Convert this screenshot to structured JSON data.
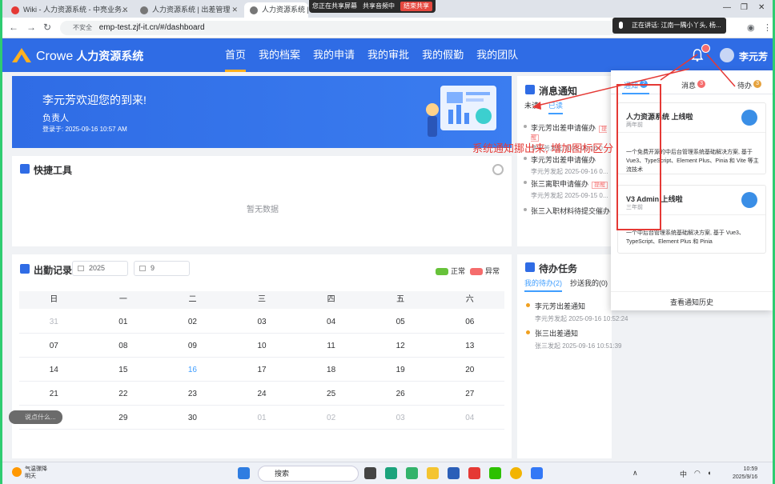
{
  "browser": {
    "tabs": [
      {
        "title": "Wiki - 人力资源系统 - 中亮业务..."
      },
      {
        "title": "人力资源系统 | 出差管理"
      },
      {
        "title": "人力资源系统 | 首页"
      }
    ],
    "share_notice": "您正在共享屏幕",
    "share_audio": "共享音频中",
    "share_stop": "结束共享",
    "speaking": "正在讲话: 江南一隅小丫头, 杨...",
    "url_insecure": "不安全",
    "url": "emp-test.zjf-it.cn/#/dashboard"
  },
  "header": {
    "brand": "Crowe",
    "system_name": "人力资源系统",
    "nav": [
      "首页",
      "我的档案",
      "我的申请",
      "我的审批",
      "我的假勤",
      "我的团队"
    ],
    "active_nav": 0,
    "username": "李元芳",
    "colors": {
      "primary": "#2f6ce5",
      "accent": "#ffb020"
    }
  },
  "welcome": {
    "greeting": "李元芳欢迎您的到来!",
    "role": "负责人",
    "login_label": "登录于: 2025-09-16 10:57 AM"
  },
  "quick_tools": {
    "title": "快捷工具",
    "empty": "暂无数据"
  },
  "messages": {
    "title": "消息通知",
    "tabs": [
      "未读",
      "已读"
    ],
    "remind_badge": "提醒",
    "items": [
      {
        "title": "李元芳出差申请催办",
        "sub": "李元芳发起  2025-09-16 0...",
        "remind": true
      },
      {
        "title": "李元芳出差申请催办",
        "sub": "李元芳发起  2025-09-16 0...",
        "remind": false
      },
      {
        "title": "张三离职申请催办",
        "sub": "李元芳发起  2025-09-15 0...",
        "remind": true
      },
      {
        "title": "张三入职材料待提交催办",
        "sub": "",
        "remind": false
      }
    ]
  },
  "attendance": {
    "title": "出勤记录",
    "year": "2025",
    "month": "9",
    "legend_normal": "正常",
    "legend_abnormal": "异常",
    "normal_color": "#67c23a",
    "abnormal_color": "#f56c6c",
    "weekdays": [
      "日",
      "一",
      "二",
      "三",
      "四",
      "五",
      "六"
    ],
    "weeks": [
      [
        "31",
        "01",
        "02",
        "03",
        "04",
        "05",
        "06"
      ],
      [
        "07",
        "08",
        "09",
        "10",
        "11",
        "12",
        "13"
      ],
      [
        "14",
        "15",
        "16",
        "17",
        "18",
        "19",
        "20"
      ],
      [
        "21",
        "22",
        "23",
        "24",
        "25",
        "26",
        "27"
      ],
      [
        "28",
        "29",
        "30",
        "01",
        "02",
        "03",
        "04"
      ]
    ],
    "chat_hint": "说点什么..."
  },
  "todo": {
    "title": "待办任务",
    "tabs": [
      "我的待办(2)",
      "抄送我的(0)"
    ],
    "items": [
      {
        "title": "李元芳出差通知",
        "sub": "李元芳发起  2025-09-16 10:52:24"
      },
      {
        "title": "张三出差通知",
        "sub": "张三发起  2025-09-16 10:51:39"
      }
    ]
  },
  "notice_panel": {
    "tabs": [
      {
        "label": "通知",
        "count": "2",
        "color": "#409eff"
      },
      {
        "label": "消息",
        "count": "3",
        "color": "#f56c6c"
      },
      {
        "label": "待办",
        "count": "3",
        "color": "#e6a23c"
      }
    ],
    "cards": [
      {
        "title": "人力资源系统 上线啦",
        "time": "两年前",
        "body": "一个免费开源的中后台管理系统基础解决方案, 基于 Vue3、TypeScript、Element Plus、Pinia 和 Vite 等主流技术"
      },
      {
        "title": "V3 Admin 上线啦",
        "time": "三年前",
        "body": "一个中后台管理系统基础解决方案, 基于 Vue3、TypeScript、Element Plus 和 Pinia"
      }
    ],
    "history": "查看通知历史"
  },
  "annotation": {
    "text": "系统通知挪出来, 增加图标区分"
  },
  "taskbar": {
    "weather_title": "气温骤降",
    "weather_sub": "明天",
    "search": "搜索",
    "ime": "中",
    "time": "10:59",
    "date": "2025/9/16"
  }
}
